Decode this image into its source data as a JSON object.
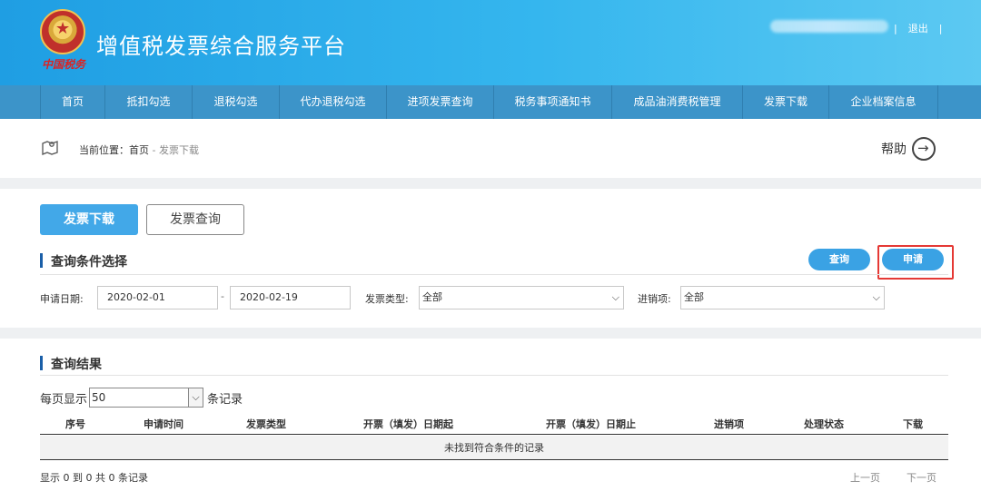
{
  "header": {
    "title": "增值税发票综合服务平台",
    "logo_text": "中国税务",
    "separator": "|",
    "logout": "退出"
  },
  "nav": [
    {
      "label": "首页",
      "w": 72
    },
    {
      "label": "抵扣勾选",
      "w": 96
    },
    {
      "label": "退税勾选",
      "w": 96
    },
    {
      "label": "代办退税勾选",
      "w": 118
    },
    {
      "label": "进项发票查询",
      "w": 118
    },
    {
      "label": "税务事项通知书",
      "w": 130
    },
    {
      "label": "成品油消费税管理",
      "w": 144
    },
    {
      "label": "发票下载",
      "w": 95
    },
    {
      "label": "企业档案信息",
      "w": 120
    }
  ],
  "breadcrumb": {
    "prefix": "当前位置：",
    "home": "首页",
    "sep": " - ",
    "current": "发票下载",
    "help": "帮助"
  },
  "tabs": {
    "download": "发票下载",
    "query": "发票查询"
  },
  "query": {
    "title": "查询条件选择",
    "query_btn": "查询",
    "apply_btn": "申请",
    "date_label": "申请日期:",
    "date_from": "2020-02-01",
    "date_to": "2020-02-19",
    "date_sep": "-",
    "type_label": "发票类型:",
    "type_value": "全部",
    "sales_label": "进销项:",
    "sales_value": "全部"
  },
  "results": {
    "title": "查询结果",
    "perpage_prefix": "每页显示",
    "perpage_value": "50",
    "perpage_suffix": "条记录",
    "columns": [
      "序号",
      "申请时间",
      "发票类型",
      "开票（填发）日期起",
      "开票（填发）日期止",
      "进销项",
      "处理状态",
      "下载"
    ],
    "empty_text": "未找到符合条件的记录",
    "summary": "显示 0 到 0 共 0 条记录",
    "prev": "上一页",
    "next": "下一页"
  }
}
